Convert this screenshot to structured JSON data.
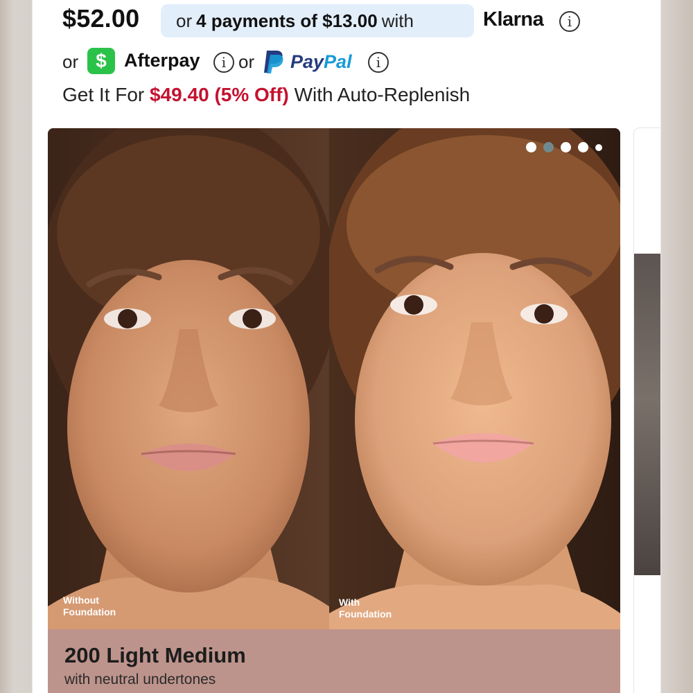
{
  "price": {
    "current": "$52.00",
    "installment_prefix": "or",
    "installment_amount": "4 payments of $13.00",
    "installment_suffix": "with",
    "klarna_label": "Klarna"
  },
  "alt_payments": {
    "or_1": "or",
    "cashapp_symbol": "$",
    "afterpay_label": "Afterpay",
    "or_2": "or",
    "paypal_part1": "Pay",
    "paypal_part2": "Pal"
  },
  "info_glyph": "i",
  "replenish": {
    "prefix": "Get It For",
    "sale_price": "$49.40 (5% Off)",
    "suffix": "With Auto-Replenish"
  },
  "carousel": {
    "left_caption_line1": "Without",
    "left_caption_line2": "Foundation",
    "right_caption_line1": "With",
    "right_caption_line2": "Foundation",
    "dot_count": 5,
    "active_dot": 2
  },
  "shade": {
    "name": "200 Light Medium",
    "description": "with neutral undertones",
    "panel_color": "#bd948c"
  },
  "colors": {
    "sale_red": "#c41230",
    "pill_blue": "#e3eefb",
    "cashapp_green": "#2bc24a",
    "paypal_dark": "#253b80",
    "paypal_light": "#179bd7"
  }
}
